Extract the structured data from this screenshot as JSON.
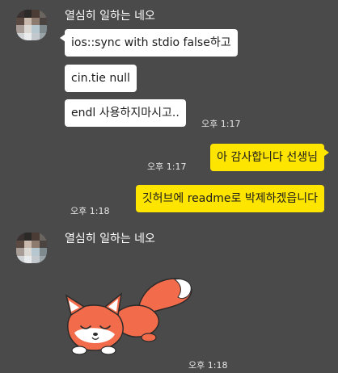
{
  "chat": {
    "groups": [
      {
        "sender": "열심히 일하는 네오"
      },
      {
        "sender": "열심히 일하는 네오"
      }
    ],
    "messages": [
      {
        "text": "ios::sync with stdio false하고"
      },
      {
        "text": "cin.tie null"
      },
      {
        "text": "endl 사용하지마시고.."
      },
      {
        "text": "아 감사합니다 선생님"
      },
      {
        "text": "깃허브에 readme로 박제하겠읍니다"
      }
    ],
    "times": [
      "오후 1:17",
      "오후 1:17",
      "오후 1:18",
      "오후 1:18"
    ]
  },
  "emoticon": {
    "icon": "sleeping-fox-sticker"
  },
  "colors": {
    "background": "#4a4a4a",
    "incoming_bubble": "#ffffff",
    "outgoing_bubble": "#fee500",
    "text": "#1c1c1c",
    "fox_orange": "#f26b4a"
  }
}
